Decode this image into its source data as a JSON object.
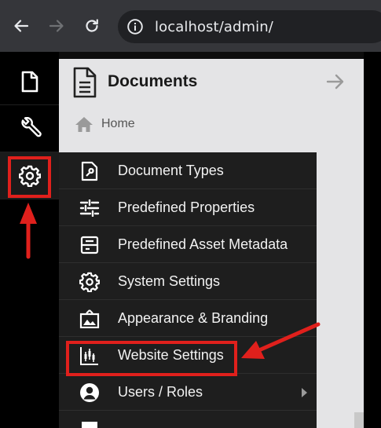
{
  "browser": {
    "url": "localhost/admin/",
    "icons": [
      "back-icon",
      "forward-icon",
      "reload-icon",
      "site-info-icon"
    ]
  },
  "rail": {
    "items": [
      {
        "icon": "document-icon"
      },
      {
        "icon": "wrench-icon"
      },
      {
        "icon": "gear-icon",
        "active": true
      }
    ]
  },
  "panel": {
    "title": "Documents",
    "home_label": "Home"
  },
  "settings_menu": {
    "items": [
      {
        "label": "Document Types",
        "icon": "document-type-icon"
      },
      {
        "label": "Predefined Properties",
        "icon": "sliders-icon"
      },
      {
        "label": "Predefined Asset Metadata",
        "icon": "asset-metadata-icon"
      },
      {
        "label": "System Settings",
        "icon": "gear-icon"
      },
      {
        "label": "Appearance & Branding",
        "icon": "image-frame-icon"
      },
      {
        "label": "Website Settings",
        "icon": "chart-icon"
      },
      {
        "label": "Users / Roles",
        "icon": "user-icon",
        "has_submenu": true
      },
      {
        "label": "",
        "icon": "thumbnail-icon"
      }
    ]
  },
  "colors": {
    "annotation": "#e0201c",
    "menu_bg": "#1e1e1e",
    "panel_bg": "#e4e4e6",
    "rail_bg": "#000000"
  }
}
